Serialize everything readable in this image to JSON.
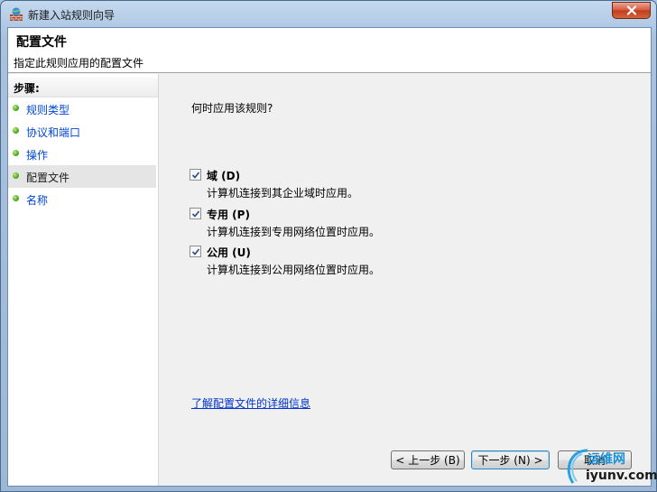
{
  "window": {
    "title": "新建入站规则向导"
  },
  "header": {
    "title": "配置文件",
    "subtitle": "指定此规则应用的配置文件"
  },
  "sidebar": {
    "heading": "步骤:",
    "items": [
      {
        "label": "规则类型",
        "current": false
      },
      {
        "label": "协议和端口",
        "current": false
      },
      {
        "label": "操作",
        "current": false
      },
      {
        "label": "配置文件",
        "current": true
      },
      {
        "label": "名称",
        "current": false
      }
    ]
  },
  "main": {
    "question": "何时应用该规则?",
    "options": [
      {
        "label": "域 (D)",
        "description": "计算机连接到其企业域时应用。",
        "checked": true
      },
      {
        "label": "专用 (P)",
        "description": "计算机连接到专用网络位置时应用。",
        "checked": true
      },
      {
        "label": "公用 (U)",
        "description": "计算机连接到公用网络位置时应用。",
        "checked": true
      }
    ],
    "learn_more": "了解配置文件的详细信息"
  },
  "buttons": {
    "back": "< 上一步 (B)",
    "next": "下一步 (N) >",
    "cancel": "取消"
  },
  "watermark": {
    "top": "运维网",
    "bottom": "iyunv.com"
  },
  "colors": {
    "link": "#0033cc",
    "step_dot": "#3c9d15",
    "close_button": "#c23a1c"
  }
}
